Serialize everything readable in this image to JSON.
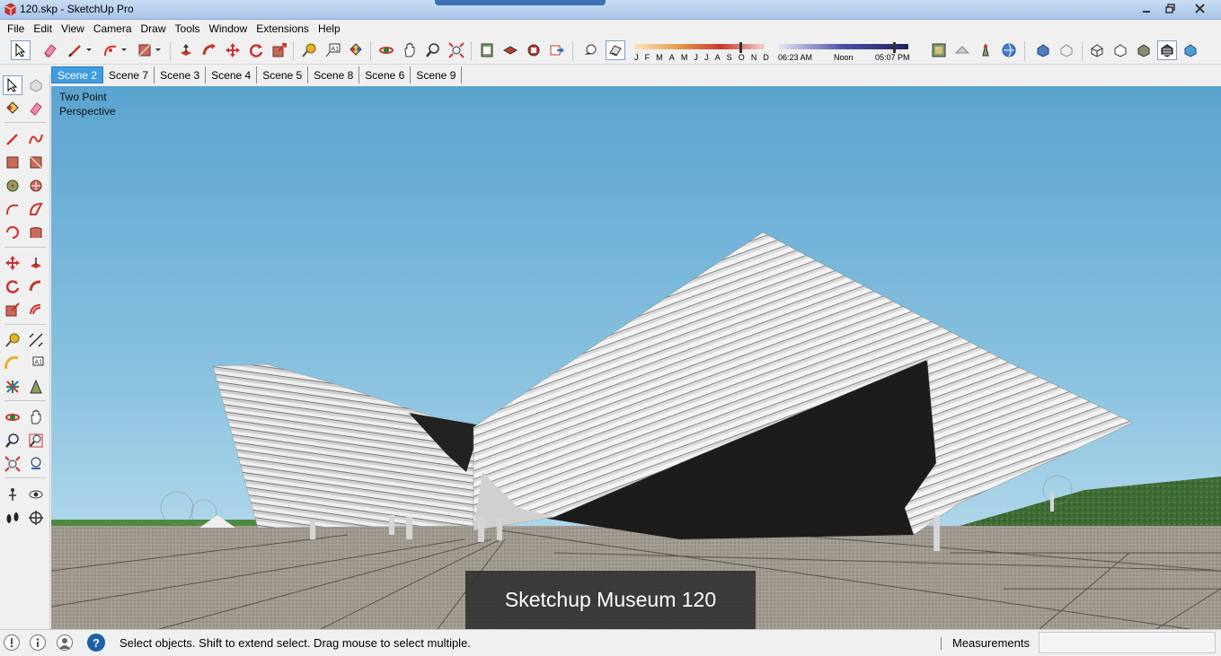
{
  "window": {
    "title": "120.skp - SketchUp Pro",
    "controls": {
      "minimize": "minimize-icon",
      "maximize": "maximize-icon",
      "close": "close-icon"
    }
  },
  "menu": [
    "File",
    "Edit",
    "View",
    "Camera",
    "Draw",
    "Tools",
    "Window",
    "Extensions",
    "Help"
  ],
  "toolbar": {
    "icons": [
      "select-icon",
      "eraser-icon",
      "pencil-icon",
      "arc-icon",
      "rectangle-icon",
      "push-pull-icon",
      "follow-me-icon",
      "move-icon",
      "rotate-icon",
      "scale-icon",
      "tape-measure-icon",
      "text-icon",
      "paint-bucket-icon",
      "orbit-icon",
      "pan-icon",
      "zoom-icon",
      "zoom-extents-icon",
      "warehouse-icon",
      "components-icon",
      "extension-warehouse-icon",
      "send-to-layout-icon",
      "shadows-icon",
      "fog-icon"
    ],
    "shadow_months": [
      "J",
      "F",
      "M",
      "A",
      "M",
      "J",
      "J",
      "A",
      "S",
      "O",
      "N",
      "D"
    ],
    "shadow_time": {
      "start": "06:23 AM",
      "mid": "Noon",
      "end": "05:07 PM"
    },
    "view_icons": [
      "geo-location-icon",
      "add-location-icon",
      "toggle-terrain-icon",
      "photo-textures-icon",
      "xray-icon",
      "back-edges-icon",
      "wireframe-icon",
      "hidden-line-icon",
      "shaded-icon",
      "shaded-textures-icon",
      "monochrome-icon"
    ]
  },
  "scenes": {
    "active": "Scene 2",
    "tabs": [
      "Scene 2",
      "Scene 7",
      "Scene 3",
      "Scene 4",
      "Scene 5",
      "Scene 8",
      "Scene 6",
      "Scene 9"
    ]
  },
  "left_tools": [
    "select-icon",
    "component-icon",
    "paint-bucket-icon",
    "eraser-icon",
    "line-icon",
    "freehand-icon",
    "rectangle-icon",
    "rotated-rectangle-icon",
    "circle-icon",
    "polygon-icon",
    "arc-icon",
    "pie-icon",
    "two-point-arc-icon",
    "three-point-arc-icon",
    "move-icon",
    "push-pull-icon",
    "rotate-icon",
    "follow-me-icon",
    "scale-icon",
    "offset-icon",
    "tape-measure-icon",
    "dimension-icon",
    "protractor-icon",
    "text-icon",
    "axes-icon",
    "3d-text-icon",
    "orbit-icon",
    "pan-icon",
    "zoom-icon",
    "zoom-window-icon",
    "zoom-extents-icon",
    "previous-view-icon",
    "position-camera-icon",
    "look-around-icon",
    "walk-icon",
    "section-plane-icon"
  ],
  "viewport": {
    "camera_mode_line1": "Two Point",
    "camera_mode_line2": "Perspective",
    "caption": "Sketchup Museum 120"
  },
  "status": {
    "message": "Select objects. Shift to extend select. Drag mouse to select multiple.",
    "measurements_label": "Measurements",
    "measurements_value": ""
  },
  "colors": {
    "sky_top": "#5ba3d0",
    "sky_bottom": "#b3d9ea",
    "ground": "#9e978e",
    "grass": "#3f6b35",
    "building_light": "#e8e8e8",
    "building_dark": "#1c1c1c",
    "scene_active": "#3f9de0"
  }
}
